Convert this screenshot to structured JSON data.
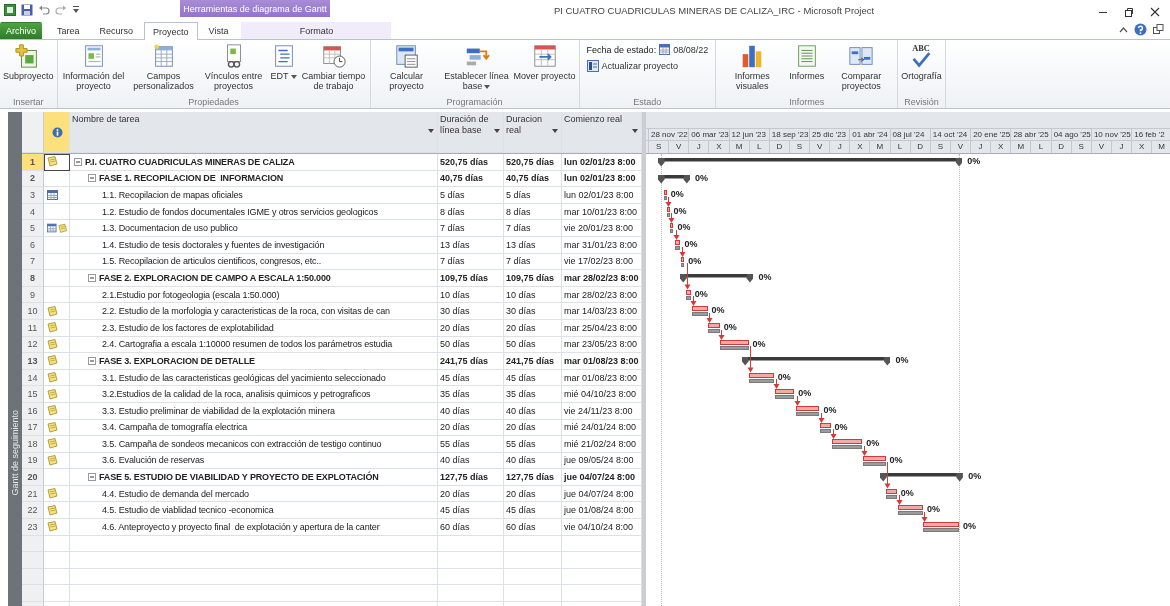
{
  "window": {
    "title": "PI CUATRO CUADRICULAS MINERAS DE CALIZA_IRC  -  Microsoft Project"
  },
  "ribbon_tabs": {
    "context_group": "Herramientas de diagrama de Gantt",
    "tabs": [
      {
        "label": "Archivo",
        "kind": "file",
        "selected": false
      },
      {
        "label": "Tarea",
        "kind": "normal",
        "selected": false
      },
      {
        "label": "Recurso",
        "kind": "normal",
        "selected": false
      },
      {
        "label": "Proyecto",
        "kind": "normal",
        "selected": true
      },
      {
        "label": "Vista",
        "kind": "normal",
        "selected": false
      },
      {
        "label": "Formato",
        "kind": "contextual",
        "selected": false
      }
    ]
  },
  "ribbon": {
    "groups": [
      {
        "label": "Insertar",
        "kind": "commands",
        "commands": [
          {
            "label": "Subproyecto",
            "dropdown": false
          }
        ]
      },
      {
        "label": "Propiedades",
        "kind": "commands",
        "commands": [
          {
            "label": "Información del proyecto",
            "dropdown": false
          },
          {
            "label": "Campos personalizados",
            "dropdown": false
          },
          {
            "label": "Vínculos entre proyectos",
            "dropdown": false
          },
          {
            "label": "EDT",
            "dropdown": true
          },
          {
            "label": "Cambiar tiempo de trabajo",
            "dropdown": false
          }
        ]
      },
      {
        "label": "Programación",
        "kind": "commands",
        "commands": [
          {
            "label": "Calcular proyecto",
            "dropdown": false
          },
          {
            "label": "Establecer línea base",
            "dropdown": true
          },
          {
            "label": "Mover proyecto",
            "dropdown": false
          }
        ]
      },
      {
        "label": "Estado",
        "kind": "status",
        "status_date": {
          "label": "Fecha de estado:",
          "value": "08/08/22"
        },
        "update_button": "Actualizar proyecto"
      },
      {
        "label": "Informes",
        "kind": "commands",
        "commands": [
          {
            "label": "Informes visuales",
            "dropdown": false
          },
          {
            "label": "Informes",
            "dropdown": false
          },
          {
            "label": "Comparar proyectos",
            "dropdown": false
          }
        ]
      },
      {
        "label": "Revisión",
        "kind": "commands",
        "commands": [
          {
            "label": "Ortografía",
            "dropdown": false,
            "icon_text": "ABC"
          }
        ]
      }
    ]
  },
  "table": {
    "view_label": "Gantt de seguimiento",
    "columns": [
      {
        "label": "Nombre de tarea"
      },
      {
        "label": "Duración de línea base"
      },
      {
        "label": "Duracion real"
      },
      {
        "label": "Comienzo real"
      }
    ],
    "rows": [
      {
        "id": "1",
        "kind": "summary",
        "calendar": false,
        "note": true,
        "name": "P.I. CUATRO CUADRICULAS MINERAS DE CALIZA",
        "baseline_duration": "520,75 días",
        "actual_duration": "520,75 días",
        "actual_start": "lun 02/01/23 8:00",
        "progress": "0%",
        "selected": true,
        "expanded": true,
        "children": [
          {
            "id": "2",
            "kind": "summary",
            "calendar": false,
            "note": false,
            "name": "FASE 1. RECOPILACION DE  INFORMACION",
            "baseline_duration": "40,75 días",
            "actual_duration": "40,75 días",
            "actual_start": "lun 02/01/23 8:00",
            "progress": "0%",
            "selected": false,
            "expanded": true,
            "children": [
              {
                "id": "3",
                "kind": "task",
                "calendar": true,
                "note": false,
                "name": "1.1. Recopilacion de mapas oficiales",
                "baseline_duration": "5 días",
                "actual_duration": "5 días",
                "actual_start": "lun 02/01/23 8:00",
                "progress": "0%",
                "selected": false
              },
              {
                "id": "4",
                "kind": "task",
                "calendar": false,
                "note": false,
                "name": "1.2. Estudio de fondos documentales IGME y otros servicios geologicos",
                "baseline_duration": "8 días",
                "actual_duration": "8 días",
                "actual_start": "mar 10/01/23 8:00",
                "progress": "0%",
                "selected": false
              },
              {
                "id": "5",
                "kind": "task",
                "calendar": true,
                "note": true,
                "name": "1.3. Documentacion de uso publico",
                "baseline_duration": "7 días",
                "actual_duration": "7 días",
                "actual_start": "vie 20/01/23 8:00",
                "progress": "0%",
                "selected": false
              },
              {
                "id": "6",
                "kind": "task",
                "calendar": false,
                "note": false,
                "name": "1.4. Estudio de tesis doctorales y fuentes de investigación",
                "baseline_duration": "13 días",
                "actual_duration": "13 días",
                "actual_start": "mar 31/01/23 8:00",
                "progress": "0%",
                "selected": false
              },
              {
                "id": "7",
                "kind": "task",
                "calendar": false,
                "note": false,
                "name": "1.5. Recopilacion de articulos cientificos, congresos, etc..",
                "baseline_duration": "7 días",
                "actual_duration": "7 días",
                "actual_start": "vie 17/02/23 8:00",
                "progress": "0%",
                "selected": false
              }
            ]
          },
          {
            "id": "8",
            "kind": "summary",
            "calendar": false,
            "note": false,
            "name": "FASE 2. EXPLORACION DE CAMPO A ESCALA 1:50.000",
            "baseline_duration": "109,75 días",
            "actual_duration": "109,75 días",
            "actual_start": "mar 28/02/23 8:00",
            "progress": "0%",
            "selected": false,
            "expanded": true,
            "children": [
              {
                "id": "9",
                "kind": "task",
                "calendar": false,
                "note": false,
                "name": "2.1.Estudio por fotogeologia (escala 1:50.000)",
                "baseline_duration": "10 días",
                "actual_duration": "10 días",
                "actual_start": "mar 28/02/23 8:00",
                "progress": "0%",
                "selected": false
              },
              {
                "id": "10",
                "kind": "task",
                "calendar": false,
                "note": true,
                "name": "2.2. Estudio de la morfologia y caracteristicas de la roca, con visitas de can",
                "baseline_duration": "30 días",
                "actual_duration": "30 días",
                "actual_start": "mar 14/03/23 8:00",
                "progress": "0%",
                "selected": false
              },
              {
                "id": "11",
                "kind": "task",
                "calendar": false,
                "note": true,
                "name": "2.3. Estudio de los factores de explotabilidad",
                "baseline_duration": "20 días",
                "actual_duration": "20 días",
                "actual_start": "mar 25/04/23 8:00",
                "progress": "0%",
                "selected": false
              },
              {
                "id": "12",
                "kind": "task",
                "calendar": false,
                "note": true,
                "name": "2.4. Cartografia a escala 1:10000 resumen de todos los parámetros estudia",
                "baseline_duration": "50 días",
                "actual_duration": "50 días",
                "actual_start": "mar 23/05/23 8:00",
                "progress": "0%",
                "selected": false
              }
            ]
          },
          {
            "id": "13",
            "kind": "summary",
            "calendar": false,
            "note": true,
            "name": "FASE 3. EXPLORACION DE DETALLE",
            "baseline_duration": "241,75 días",
            "actual_duration": "241,75 días",
            "actual_start": "mar 01/08/23 8:00",
            "progress": "0%",
            "selected": false,
            "expanded": true,
            "children": [
              {
                "id": "14",
                "kind": "task",
                "calendar": false,
                "note": true,
                "name": "3.1. Estudio de las caracteristicas geológicas del yacimiento seleccionado",
                "baseline_duration": "45 días",
                "actual_duration": "45 días",
                "actual_start": "mar 01/08/23 8:00",
                "progress": "0%",
                "selected": false
              },
              {
                "id": "15",
                "kind": "task",
                "calendar": false,
                "note": true,
                "name": "3.2.Estudios de la calidad de la roca, analisis quimicos y petrograficos",
                "baseline_duration": "35 días",
                "actual_duration": "35 días",
                "actual_start": "mié 04/10/23 8:00",
                "progress": "0%",
                "selected": false
              },
              {
                "id": "16",
                "kind": "task",
                "calendar": false,
                "note": true,
                "name": "3.3. Estudio preliminar de viabilidad de la explotación minera",
                "baseline_duration": "40 días",
                "actual_duration": "40 días",
                "actual_start": "vie 24/11/23 8:00",
                "progress": "0%",
                "selected": false
              },
              {
                "id": "17",
                "kind": "task",
                "calendar": false,
                "note": true,
                "name": "3.4. Campaña de tomografía electrica",
                "baseline_duration": "20 días",
                "actual_duration": "20 días",
                "actual_start": "mié 24/01/24 8:00",
                "progress": "0%",
                "selected": false
              },
              {
                "id": "18",
                "kind": "task",
                "calendar": false,
                "note": true,
                "name": "3.5. Campaña de sondeos mecanicos con extracción de testigo continuo",
                "baseline_duration": "55 días",
                "actual_duration": "55 días",
                "actual_start": "mié 21/02/24 8:00",
                "progress": "0%",
                "selected": false
              },
              {
                "id": "19",
                "kind": "task",
                "calendar": false,
                "note": true,
                "name": "3.6. Evalución de reservas",
                "baseline_duration": "40 días",
                "actual_duration": "40 días",
                "actual_start": "jue 09/05/24 8:00",
                "progress": "0%",
                "selected": false
              }
            ]
          },
          {
            "id": "20",
            "kind": "summary",
            "calendar": false,
            "note": false,
            "name": "FASE 5. ESTUDIO DE VIABILIDAD Y PROYECTO DE EXPLOTACIÓN",
            "baseline_duration": "127,75 días",
            "actual_duration": "127,75 días",
            "actual_start": "jue 04/07/24 8:00",
            "progress": "0%",
            "selected": false,
            "expanded": true,
            "children": [
              {
                "id": "21",
                "kind": "task",
                "calendar": false,
                "note": true,
                "name": "4.4. Estudio de demanda del mercado",
                "baseline_duration": "20 días",
                "actual_duration": "20 días",
                "actual_start": "jue 04/07/24 8:00",
                "progress": "0%",
                "selected": false
              },
              {
                "id": "22",
                "kind": "task",
                "calendar": false,
                "note": true,
                "name": "4.5. Estudio de viablidad tecnico -economica",
                "baseline_duration": "45 días",
                "actual_duration": "45 días",
                "actual_start": "jue 01/08/24 8:00",
                "progress": "0%",
                "selected": false
              },
              {
                "id": "23",
                "kind": "task",
                "calendar": false,
                "note": true,
                "name": "4.6. Anteproyecto y proyecto final  de explotación y apertura de la canter",
                "baseline_duration": "60 días",
                "actual_duration": "60 días",
                "actual_start": "vie 04/10/24 8:00",
                "progress": "0%",
                "selected": false
              }
            ]
          }
        ]
      }
    ]
  },
  "gantt": {
    "timescale": {
      "major": [
        "28 nov '22",
        "06 mar '23",
        "12 jun '23",
        "18 sep '23",
        "25 dic '23",
        "01 abr '24",
        "08 jul '24",
        "14 oct '24",
        "20 ene '25",
        "28 abr '25",
        "04 ago '25",
        "10 nov '25",
        "16 feb '2"
      ],
      "minor": [
        "S",
        "V",
        "J",
        "X",
        "M",
        "L",
        "D",
        "S",
        "V",
        "J",
        "X",
        "M",
        "L",
        "D",
        "S",
        "V",
        "J",
        "X",
        "M",
        "L",
        "D",
        "S",
        "V",
        "J",
        "X",
        "M"
      ]
    }
  }
}
